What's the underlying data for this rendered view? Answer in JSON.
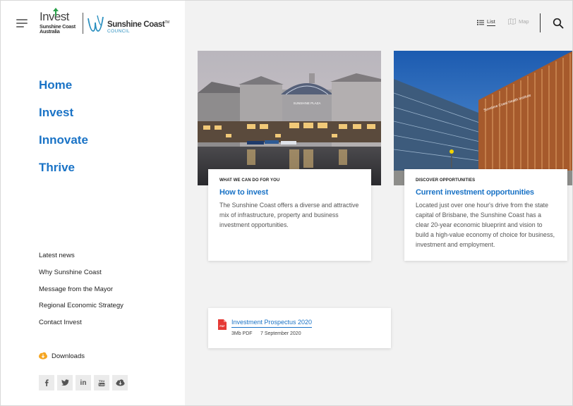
{
  "logo": {
    "invest_word": "Invest",
    "invest_sub1": "Sunshine Coast",
    "invest_sub2": "Australia",
    "council_name": "Sunshine Coast",
    "council_tm": "TM",
    "council_sub": "COUNCIL"
  },
  "main_nav": [
    "Home",
    "Invest",
    "Innovate",
    "Thrive"
  ],
  "sub_nav": [
    "Latest news",
    "Why Sunshine Coast",
    "Message from the Mayor",
    "Regional Economic Strategy",
    "Contact Invest"
  ],
  "downloads_label": "Downloads",
  "socials": [
    "facebook-icon",
    "twitter-icon",
    "linkedin-icon",
    "youtube-icon",
    "cloud-download-icon"
  ],
  "view_toggle": {
    "list_label": "List",
    "map_label": "Map",
    "active": "List"
  },
  "cards": [
    {
      "eyebrow": "WHAT WE CAN DO FOR YOU",
      "title": "How to invest",
      "description": "The Sunshine Coast offers a diverse and attractive mix of infrastructure, property and business investment opportunities.",
      "image_sign": "SUNSHINE PLAZA"
    },
    {
      "eyebrow": "DISCOVER OPPORTUNITIES",
      "title": "Current investment opportunities",
      "description": "Located just over one hour's drive from the state capital of Brisbane, the Sunshine Coast has a clear 20-year economic blueprint and vision to build a high-value economy of choice for business, investment and employment.",
      "image_sign": "Sunshine Coast Health Institute"
    }
  ],
  "document": {
    "icon_label": "PDF",
    "title": "Investment Prospectus 2020",
    "size": "3Mb PDF",
    "date": "7 September 2020"
  },
  "colors": {
    "link_blue": "#1a73c6",
    "download_orange": "#f5a623",
    "pdf_red": "#e53935",
    "background": "#f2f2f2"
  }
}
